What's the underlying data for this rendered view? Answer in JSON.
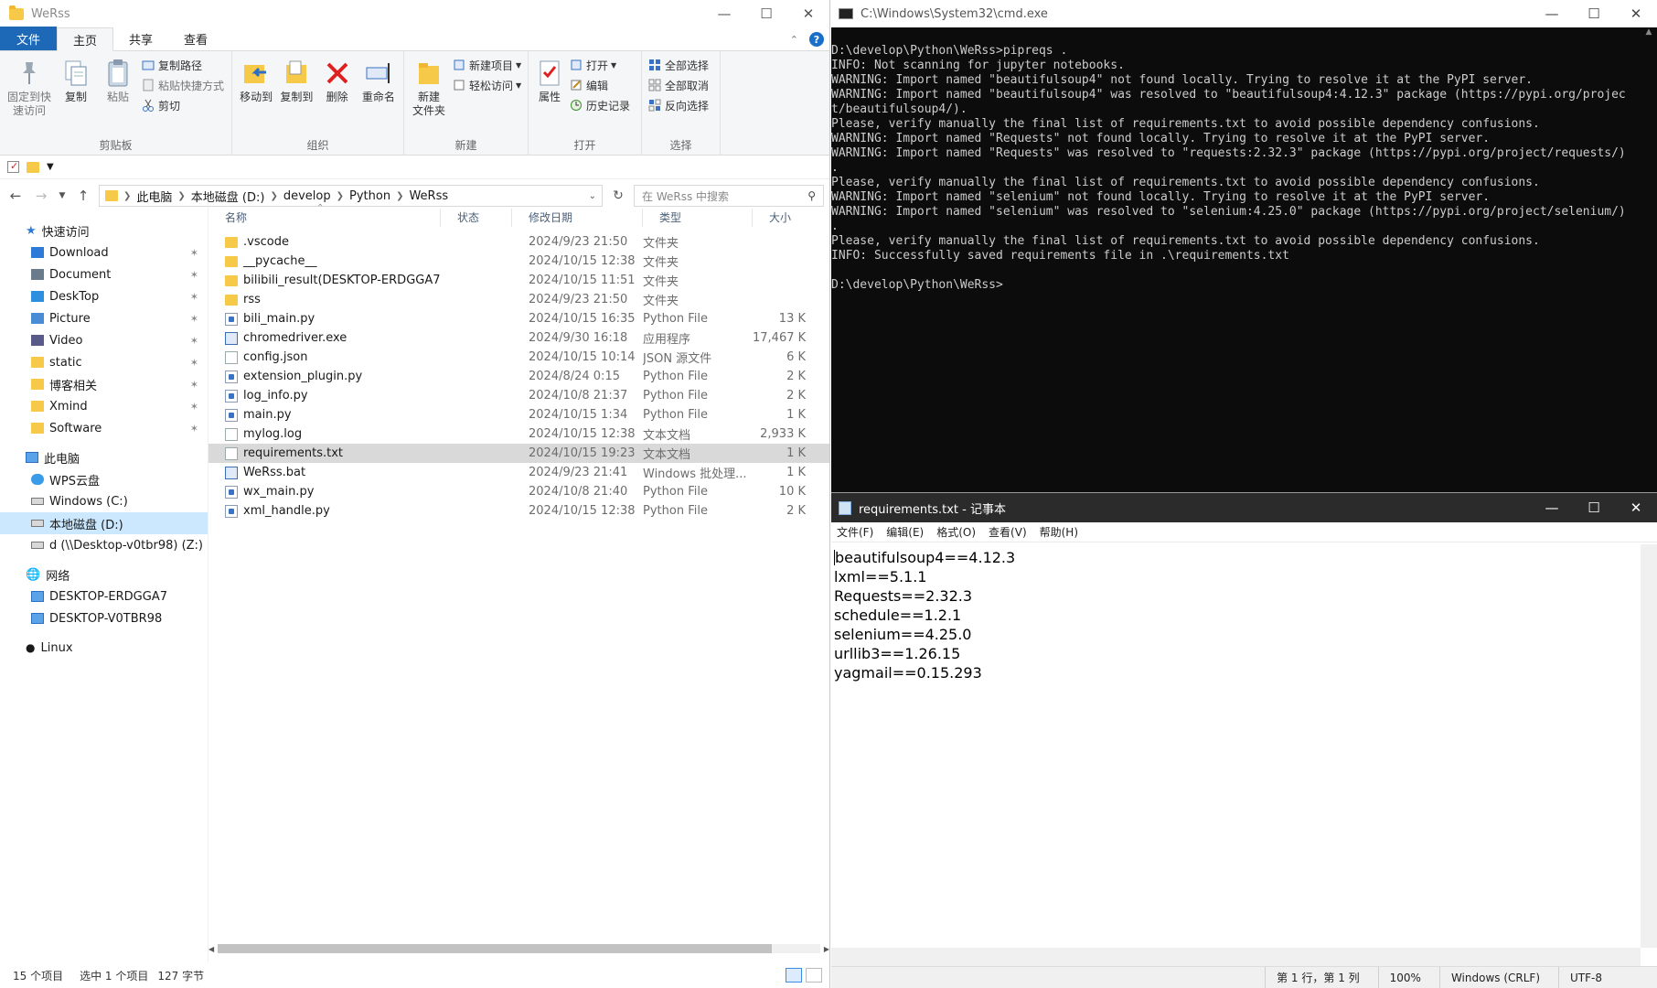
{
  "explorer": {
    "title": "WeRss",
    "tabs": [
      "文件",
      "主页",
      "共享",
      "查看"
    ],
    "ribbon": {
      "clipboard": {
        "group": "剪贴板",
        "pin": "固定到快\n速访问",
        "copy": "复制",
        "paste": "粘贴",
        "copy_path": "复制路径",
        "paste_shortcut": "粘贴快捷方式",
        "cut": "剪切"
      },
      "organize": {
        "group": "组织",
        "move_to": "移动到",
        "copy_to": "复制到",
        "delete": "删除",
        "rename": "重命名"
      },
      "new": {
        "group": "新建",
        "new_folder": "新建\n文件夹",
        "new_item": "新建项目",
        "easy_access": "轻松访问"
      },
      "open": {
        "group": "打开",
        "properties": "属性",
        "open": "打开",
        "edit": "编辑",
        "history": "历史记录"
      },
      "select": {
        "group": "选择",
        "select_all": "全部选择",
        "select_none": "全部取消",
        "invert": "反向选择"
      }
    },
    "breadcrumb": [
      "此电脑",
      "本地磁盘 (D:)",
      "develop",
      "Python",
      "WeRss"
    ],
    "search_placeholder": "在 WeRss 中搜索",
    "nav": {
      "quick_access": "快速访问",
      "pinned": [
        "Download",
        "Document",
        "DeskTop",
        "Picture",
        "Video",
        "static",
        "博客相关",
        "Xmind",
        "Software"
      ],
      "this_pc": "此电脑",
      "pc_items": [
        "WPS云盘",
        "Windows (C:)",
        "本地磁盘 (D:)",
        "d (\\\\Desktop-v0tbr98) (Z:)"
      ],
      "network": "网络",
      "network_items": [
        "DESKTOP-ERDGGA7",
        "DESKTOP-V0TBR98"
      ],
      "linux": "Linux"
    },
    "columns": [
      "名称",
      "状态",
      "修改日期",
      "类型",
      "大小"
    ],
    "files": [
      {
        "name": ".vscode",
        "date": "2024/9/23 21:50",
        "type": "文件夹",
        "size": "",
        "icon": "folder"
      },
      {
        "name": "__pycache__",
        "date": "2024/10/15 12:38",
        "type": "文件夹",
        "size": "",
        "icon": "folder"
      },
      {
        "name": "bilibili_result(DESKTOP-ERDGGA7)",
        "date": "2024/10/15 11:51",
        "type": "文件夹",
        "size": "",
        "icon": "folder"
      },
      {
        "name": "rss",
        "date": "2024/9/23 21:50",
        "type": "文件夹",
        "size": "",
        "icon": "folder"
      },
      {
        "name": "bili_main.py",
        "date": "2024/10/15 16:35",
        "type": "Python File",
        "size": "13 K",
        "icon": "py"
      },
      {
        "name": "chromedriver.exe",
        "date": "2024/9/30 16:18",
        "type": "应用程序",
        "size": "17,467 K",
        "icon": "exe"
      },
      {
        "name": "config.json",
        "date": "2024/10/15 10:14",
        "type": "JSON 源文件",
        "size": "6 K",
        "icon": "txt"
      },
      {
        "name": "extension_plugin.py",
        "date": "2024/8/24 0:15",
        "type": "Python File",
        "size": "2 K",
        "icon": "py"
      },
      {
        "name": "log_info.py",
        "date": "2024/10/8 21:37",
        "type": "Python File",
        "size": "2 K",
        "icon": "py"
      },
      {
        "name": "main.py",
        "date": "2024/10/15 1:34",
        "type": "Python File",
        "size": "1 K",
        "icon": "py"
      },
      {
        "name": "mylog.log",
        "date": "2024/10/15 12:38",
        "type": "文本文档",
        "size": "2,933 K",
        "icon": "txt"
      },
      {
        "name": "requirements.txt",
        "date": "2024/10/15 19:23",
        "type": "文本文档",
        "size": "1 K",
        "icon": "txt",
        "selected": true
      },
      {
        "name": "WeRss.bat",
        "date": "2024/9/23 21:41",
        "type": "Windows 批处理...",
        "size": "1 K",
        "icon": "exe"
      },
      {
        "name": "wx_main.py",
        "date": "2024/10/8 21:40",
        "type": "Python File",
        "size": "10 K",
        "icon": "py"
      },
      {
        "name": "xml_handle.py",
        "date": "2024/10/15 12:38",
        "type": "Python File",
        "size": "2 K",
        "icon": "py"
      }
    ],
    "status": {
      "count": "15 个项目",
      "selected": "选中 1 个项目",
      "size": "127 字节"
    }
  },
  "cmd": {
    "title": "C:\\Windows\\System32\\cmd.exe",
    "lines": [
      "D:\\develop\\Python\\WeRss>pipreqs .",
      "INFO: Not scanning for jupyter notebooks.",
      "WARNING: Import named \"beautifulsoup4\" not found locally. Trying to resolve it at the PyPI server.",
      "WARNING: Import named \"beautifulsoup4\" was resolved to \"beautifulsoup4:4.12.3\" package (https://pypi.org/projec",
      "t/beautifulsoup4/).",
      "Please, verify manually the final list of requirements.txt to avoid possible dependency confusions.",
      "WARNING: Import named \"Requests\" not found locally. Trying to resolve it at the PyPI server.",
      "WARNING: Import named \"Requests\" was resolved to \"requests:2.32.3\" package (https://pypi.org/project/requests/)",
      ".",
      "Please, verify manually the final list of requirements.txt to avoid possible dependency confusions.",
      "WARNING: Import named \"selenium\" not found locally. Trying to resolve it at the PyPI server.",
      "WARNING: Import named \"selenium\" was resolved to \"selenium:4.25.0\" package (https://pypi.org/project/selenium/)",
      ".",
      "Please, verify manually the final list of requirements.txt to avoid possible dependency confusions.",
      "INFO: Successfully saved requirements file in .\\requirements.txt",
      "",
      "D:\\develop\\Python\\WeRss>"
    ]
  },
  "notepad": {
    "title": "requirements.txt - 记事本",
    "menu": [
      "文件(F)",
      "编辑(E)",
      "格式(O)",
      "查看(V)",
      "帮助(H)"
    ],
    "lines": [
      "beautifulsoup4==4.12.3",
      "lxml==5.1.1",
      "Requests==2.32.3",
      "schedule==1.2.1",
      "selenium==4.25.0",
      "urllib3==1.26.15",
      "yagmail==0.15.293"
    ],
    "status": {
      "position": "第 1 行，第 1 列",
      "zoom": "100%",
      "eol": "Windows (CRLF)",
      "encoding": "UTF-8"
    }
  }
}
